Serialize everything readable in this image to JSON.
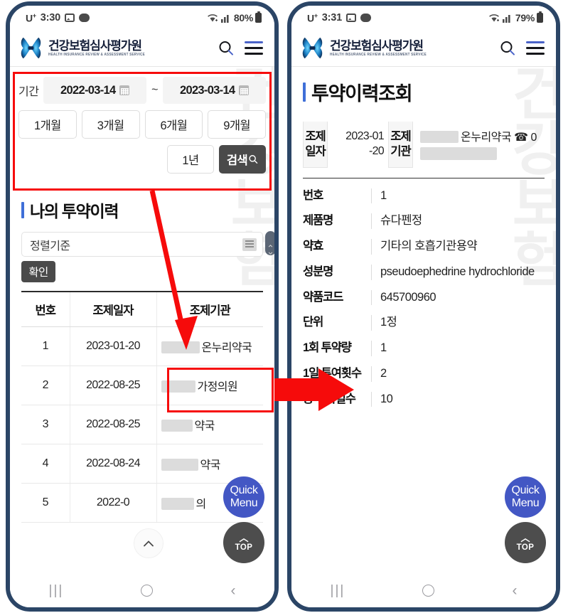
{
  "left_phone": {
    "status_bar": {
      "carrier": "U",
      "carrier_sup": "+",
      "time": "3:30",
      "battery": "80%",
      "icons": [
        "photo-icon",
        "chat-icon",
        "wifi-icon",
        "signal-icon",
        "battery-icon"
      ]
    },
    "app_header": {
      "brand_kr": "건강보험심사평가원",
      "brand_en": "HEALTH INSURANCE REVIEW & ASSESSMENT SERVICE",
      "search_label": "search-icon",
      "menu_label": "hamburger-menu-icon"
    },
    "watermark": "건강보험",
    "filter": {
      "period_label": "기간",
      "date_from": "2022-03-14",
      "date_to": "2023-03-14",
      "range_separator": "~",
      "quick_ranges": [
        "1개월",
        "3개월",
        "6개월",
        "9개월",
        "1년"
      ],
      "search_button": "검색"
    },
    "section": {
      "title": "나의 투약이력"
    },
    "sort": {
      "select_value": "정렬기준",
      "confirm_button": "확인"
    },
    "table": {
      "headers": [
        "번호",
        "조제일자",
        "조제기관"
      ],
      "rows": [
        {
          "no": "1",
          "date": "2023-01-20",
          "org": "온누리약국",
          "redacted_width": 54
        },
        {
          "no": "2",
          "date": "2022-08-25",
          "org": "가정의원",
          "redacted_width": 48
        },
        {
          "no": "3",
          "date": "2022-08-25",
          "org": "약국",
          "redacted_width": 44
        },
        {
          "no": "4",
          "date": "2022-08-24",
          "org": "약국",
          "redacted_width": 52
        },
        {
          "no": "5",
          "date": "2022-0",
          "org": "의",
          "redacted_width": 46
        }
      ]
    },
    "fabs": {
      "quick_menu_line1": "Quick",
      "quick_menu_line2": "Menu",
      "top_label": "TOP",
      "scroll_up_label": "scroll-up-icon"
    },
    "nav_bar": {
      "recent": "recent-apps-icon",
      "home": "home-icon",
      "back": "back-icon"
    }
  },
  "right_phone": {
    "status_bar": {
      "carrier": "U",
      "carrier_sup": "+",
      "time": "3:31",
      "battery": "79%"
    },
    "app_header": {
      "brand_kr": "건강보험심사평가원",
      "brand_en": "HEALTH INSURANCE REVIEW & ASSESSMENT SERVICE"
    },
    "watermark": "건강보험",
    "page_title": "투약이력조회",
    "summary_table": {
      "header_date": "조제일자",
      "value_date_line1": "2023-01",
      "value_date_line2": "-20",
      "header_org": "조제기관",
      "value_org": "온누리약국",
      "value_org_phone": "0",
      "phone_icon": "telephone-icon"
    },
    "detail": [
      {
        "label": "번호",
        "value": "1"
      },
      {
        "label": "제품명",
        "value": "슈다펜정"
      },
      {
        "label": "약효",
        "value": "기타의 호흡기관용약"
      },
      {
        "label": "성분명",
        "value": "pseudoephedrine hydrochloride"
      },
      {
        "label": "약품코드",
        "value": "645700960"
      },
      {
        "label": "단위",
        "value": "1정"
      },
      {
        "label": "1회 투약량",
        "value": "1"
      },
      {
        "label": "1일 투여횟수",
        "value": "2"
      },
      {
        "label": "총 투약일수",
        "value": "10"
      }
    ],
    "fabs": {
      "quick_menu_line1": "Quick",
      "quick_menu_line2": "Menu",
      "top_label": "TOP"
    },
    "nav_bar": {
      "recent": "recent-apps-icon",
      "home": "home-icon",
      "back": "back-icon"
    }
  },
  "annotations": {
    "highlight_filter": "red-rectangle-around-date-filter",
    "highlight_cell": "red-rectangle-around-pharmacy-cell",
    "arrow_down": "red-arrow-from-filter-to-table-header",
    "arrow_right": "red-arrow-from-left-row-to-right-detail",
    "accent_color": "#f60b0b"
  }
}
